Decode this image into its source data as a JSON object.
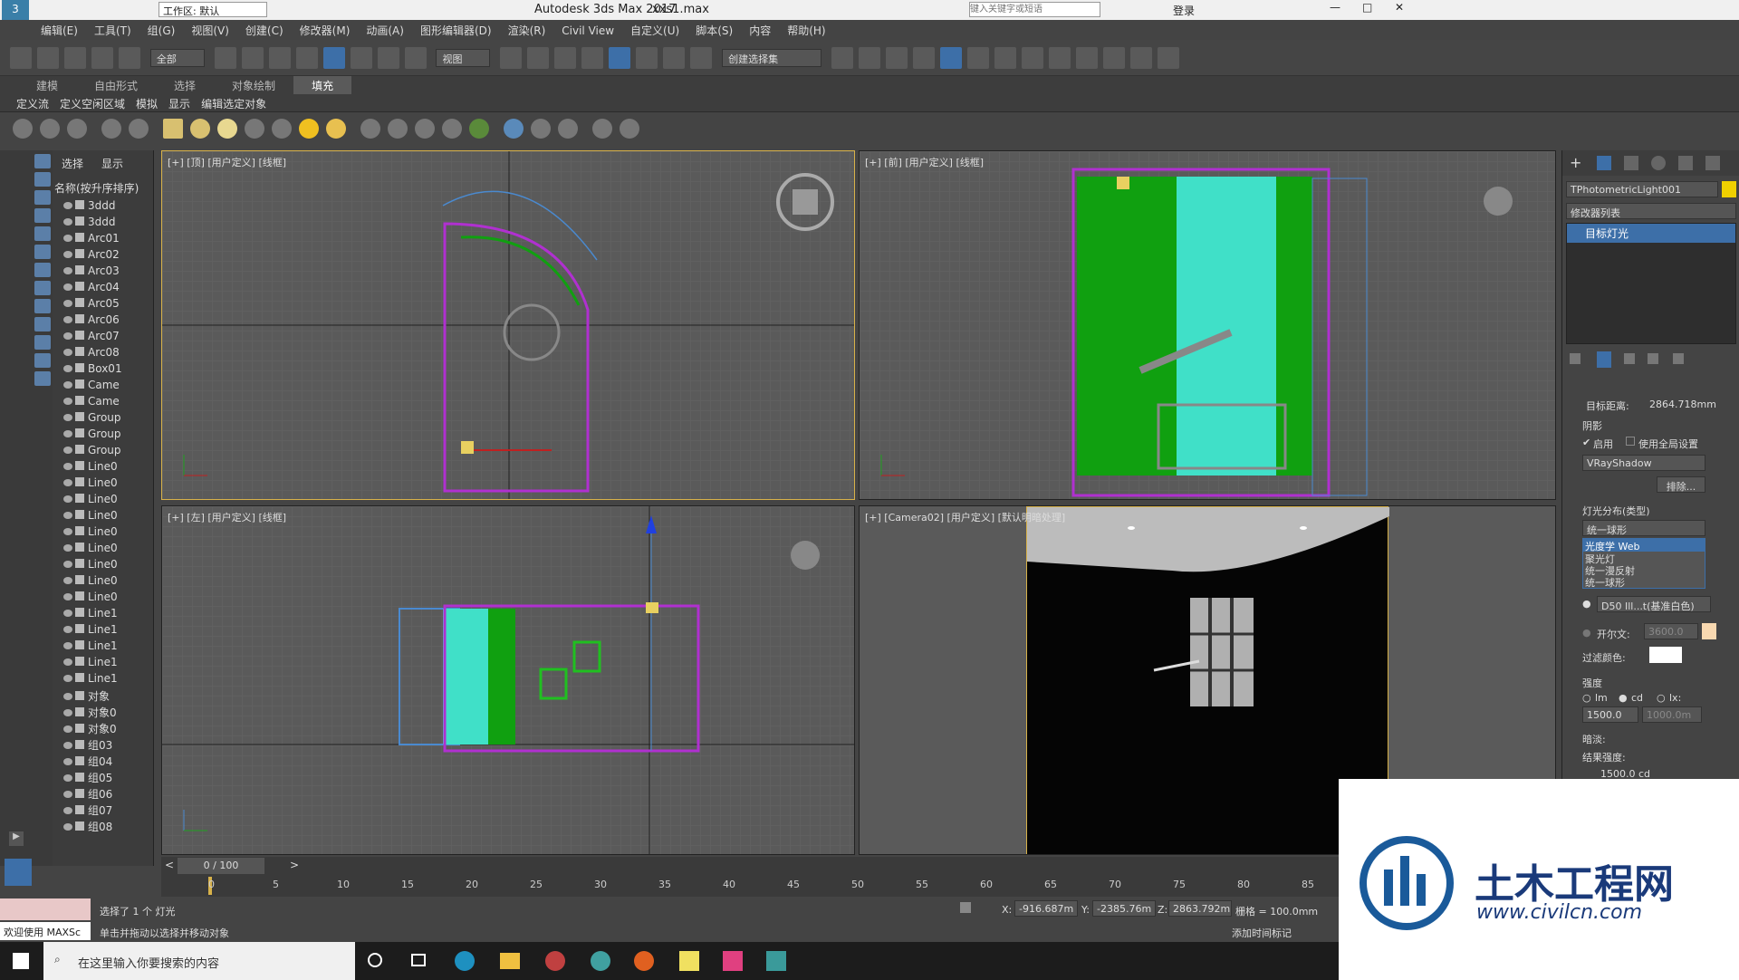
{
  "title": {
    "app": "Autodesk 3ds Max 2017",
    "file": "xxs1.max",
    "workspace": "工作区: 默认",
    "search_placeholder": "键入关键字或短语",
    "login": "登录"
  },
  "menu": [
    "编辑(E)",
    "工具(T)",
    "组(G)",
    "视图(V)",
    "创建(C)",
    "修改器(M)",
    "动画(A)",
    "图形编辑器(D)",
    "渲染(R)",
    "Civil View",
    "自定义(U)",
    "脚本(S)",
    "内容",
    "帮助(H)"
  ],
  "toolbar": {
    "filter": "全部",
    "view_dropdown": "视图",
    "selection_set": "创建选择集"
  },
  "ribbon_tabs": [
    "建模",
    "自由形式",
    "选择",
    "对象绘制",
    "填充"
  ],
  "ribbon_sub": [
    "定义流",
    "定义空闲区域",
    "模拟",
    "显示",
    "编辑选定对象"
  ],
  "explorer": {
    "tabs": [
      "选择",
      "显示"
    ],
    "header": "名称(按升序排序)",
    "items": [
      "3ddd",
      "3ddd",
      "Arc01",
      "Arc02",
      "Arc03",
      "Arc04",
      "Arc05",
      "Arc06",
      "Arc07",
      "Arc08",
      "Box01",
      "Came",
      "Came",
      "Group",
      "Group",
      "Group",
      "Line0",
      "Line0",
      "Line0",
      "Line0",
      "Line0",
      "Line0",
      "Line0",
      "Line0",
      "Line0",
      "Line1",
      "Line1",
      "Line1",
      "Line1",
      "Line1",
      "对象",
      "对象0",
      "对象0",
      "组03",
      "组04",
      "组05",
      "组06",
      "组07",
      "组08"
    ]
  },
  "viewports": [
    {
      "label": "[+] [顶] [用户定义] [线框]"
    },
    {
      "label": "[+] [前] [用户定义] [线框]"
    },
    {
      "label": "[+] [左] [用户定义] [线框]"
    },
    {
      "label": "[+] [Camera02] [用户定义] [默认明暗处理]"
    }
  ],
  "command_panel": {
    "object_name": "TPhotometricLight001",
    "modifier_list": "修改器列表",
    "stack_item": "目标灯光",
    "target_distance_label": "目标距离:",
    "target_distance": "2864.718mm",
    "shadows_title": "阴影",
    "enable": "启用",
    "use_global": "使用全局设置",
    "shadow_type": "VRayShadow",
    "exclude": "排除...",
    "distribution_title": "灯光分布(类型)",
    "distribution_value": "统一球形",
    "distribution_options": [
      "光度学 Web",
      "聚光灯",
      "统一漫反射",
      "统一球形"
    ],
    "color_preset": "D50 Ill...t(基准白色)",
    "kelvin_label": "开尔文:",
    "kelvin": "3600.0",
    "filter_color": "过滤颜色:",
    "intensity_title": "强度",
    "units": [
      "lm",
      "cd",
      "lx:"
    ],
    "intensity": "1500.0",
    "intensity2": "1000.0m",
    "dimming": "暗淡:",
    "result_intensity_label": "结果强度:",
    "result_intensity": "1500.0 cd"
  },
  "timeline": {
    "frame": "0 / 100",
    "ticks": [
      "0",
      "5",
      "10",
      "15",
      "20",
      "25",
      "30",
      "35",
      "40",
      "45",
      "50",
      "55",
      "60",
      "65",
      "70",
      "75",
      "80",
      "85"
    ]
  },
  "status": {
    "welcome": "欢迎使用 MAXSc",
    "selected": "选择了 1 个 灯光",
    "hint": "单击并拖动以选择并移动对象",
    "x": "-916.687m",
    "y": "-2385.76m",
    "z": "2863.792m",
    "grid": "栅格 = 100.0mm",
    "add_time_tag": "添加时间标记"
  },
  "taskbar": {
    "search": "在这里输入你要搜索的内容"
  },
  "logo": {
    "cn": "土木工程网",
    "url": "www.civilcn.com"
  },
  "colors": {
    "accent": "#3d6fa8",
    "green": "#10a010",
    "cyan": "#40e0c8",
    "magenta": "#b030d0"
  }
}
